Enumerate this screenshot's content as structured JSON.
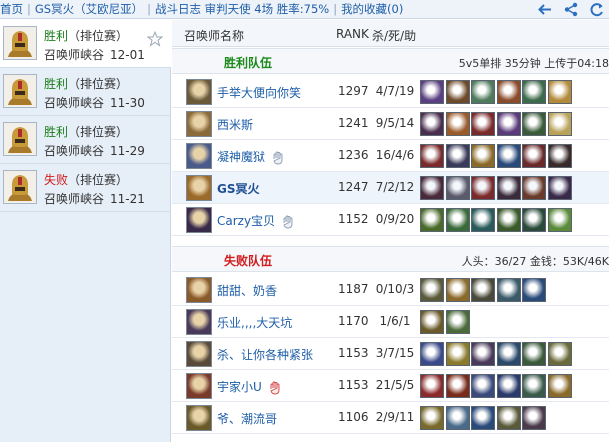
{
  "topbar": {
    "crumbs": [
      "首页",
      "GS冥火（艾欧尼亚）",
      "战斗日志 审判天使 4场 胜率:75%",
      "我的收藏(0)"
    ],
    "icons": [
      "back-arrow-icon",
      "share-icon",
      "refresh-icon"
    ]
  },
  "sidebar": {
    "matches": [
      {
        "result": "胜利",
        "type": "（排位赛）",
        "map": "召唤师峡谷",
        "date": "12-01",
        "win": true,
        "active": true
      },
      {
        "result": "胜利",
        "type": "（排位赛）",
        "map": "召唤师峡谷",
        "date": "11-30",
        "win": true,
        "active": false
      },
      {
        "result": "胜利",
        "type": "（排位赛）",
        "map": "召唤师峡谷",
        "date": "11-29",
        "win": true,
        "active": false
      },
      {
        "result": "失败",
        "type": "（排位赛）",
        "map": "召唤师峡谷",
        "date": "11-21",
        "win": false,
        "active": false
      }
    ]
  },
  "main": {
    "header": {
      "name_col": "召唤师名称",
      "rank_col": "RANK",
      "kda_col": "杀/死/助"
    },
    "win_team": {
      "title": "胜利队伍",
      "info": "5v5单排  35分钟  上传于04:18"
    },
    "lose_team": {
      "title": "失败队伍",
      "info": "人头：36/27  金钱：53K/46K"
    },
    "win_players": [
      {
        "name": "手举大便向你笑",
        "rank": "1297",
        "kda": "4/7/19",
        "champ_color": "#6a5a3a",
        "items": [
          "#5a3f82",
          "#6d4a2a",
          "#4f7a5c",
          "#8a4b2a",
          "#3d6a4a",
          "#b38a3b"
        ]
      },
      {
        "name": "西米斯",
        "rank": "1241",
        "kda": "9/5/14",
        "champ_color": "#8a6a3a",
        "items": [
          "#4a2e4e",
          "#9a5a2a",
          "#7a2a2a",
          "#5a3a7a",
          "#3a5a3a",
          "#b8a25a"
        ]
      },
      {
        "name": "凝神魔狱",
        "rank": "1236",
        "kda": "16/4/6",
        "champ_color": "#4a5a8a",
        "items": [
          "#7a2a2a",
          "#3a3a5a",
          "#8a6a2a",
          "#2a4a7a",
          "#6a2a2a",
          "#3a2a2a"
        ]
      },
      {
        "name": "GS冥火",
        "rank": "1247",
        "kda": "7/2/12",
        "champ_color": "#9a6a2a",
        "items": [
          "#4a2a3a",
          "#5a5a6a",
          "#7a2a2a",
          "#3a2a3a",
          "#6a3a2a",
          "#3a2a4a"
        ]
      },
      {
        "name": "Carzy宝贝",
        "rank": "1152",
        "kda": "0/9/20",
        "champ_color": "#3a2a4a",
        "items": [
          "#4a6a2a",
          "#3a6a3a",
          "#2a5a5a",
          "#3a5a2a",
          "#2a4a3a",
          "#5a8a3a"
        ]
      }
    ],
    "lose_players": [
      {
        "name": "甜甜、奶香",
        "rank": "1187",
        "kda": "0/10/3",
        "champ_color": "#8a5a2a",
        "items": [
          "#5a5a3a",
          "#8a6a2a",
          "#4a4a3a",
          "#3a5a6a",
          "#2a4a7a"
        ]
      },
      {
        "name": "乐业,,,,大天坑",
        "rank": "1170",
        "kda": "1/6/1",
        "champ_color": "#4a3a5a",
        "items": [
          "#6a5a2a",
          "#4a6a3a"
        ]
      },
      {
        "name": "杀、让你各种紧张",
        "rank": "1153",
        "kda": "3/7/15",
        "champ_color": "#5a4a3a",
        "items": [
          "#3a4a8a",
          "#8a7a2a",
          "#4a3a5a",
          "#2a4a6a",
          "#3a5a3a",
          "#6a6a3a"
        ]
      },
      {
        "name": "宇家小U",
        "rank": "1153",
        "kda": "21/5/5",
        "champ_color": "#7a3a2a",
        "items": [
          "#8a2a2a",
          "#7a2a1a",
          "#3a4a7a",
          "#2a3a6a",
          "#3a5a4a",
          "#8a6a2a"
        ]
      },
      {
        "name": "爷、潮流哥",
        "rank": "1106",
        "kda": "2/9/11",
        "champ_color": "#6a5a2a",
        "items": [
          "#7a6a2a",
          "#4a6a8a",
          "#2a4a7a",
          "#5a5a3a",
          "#4a3a4a"
        ]
      }
    ]
  },
  "colors": {
    "win": "#1b8a1b",
    "lose": "#d21c1c",
    "link": "#1e5ea8"
  }
}
